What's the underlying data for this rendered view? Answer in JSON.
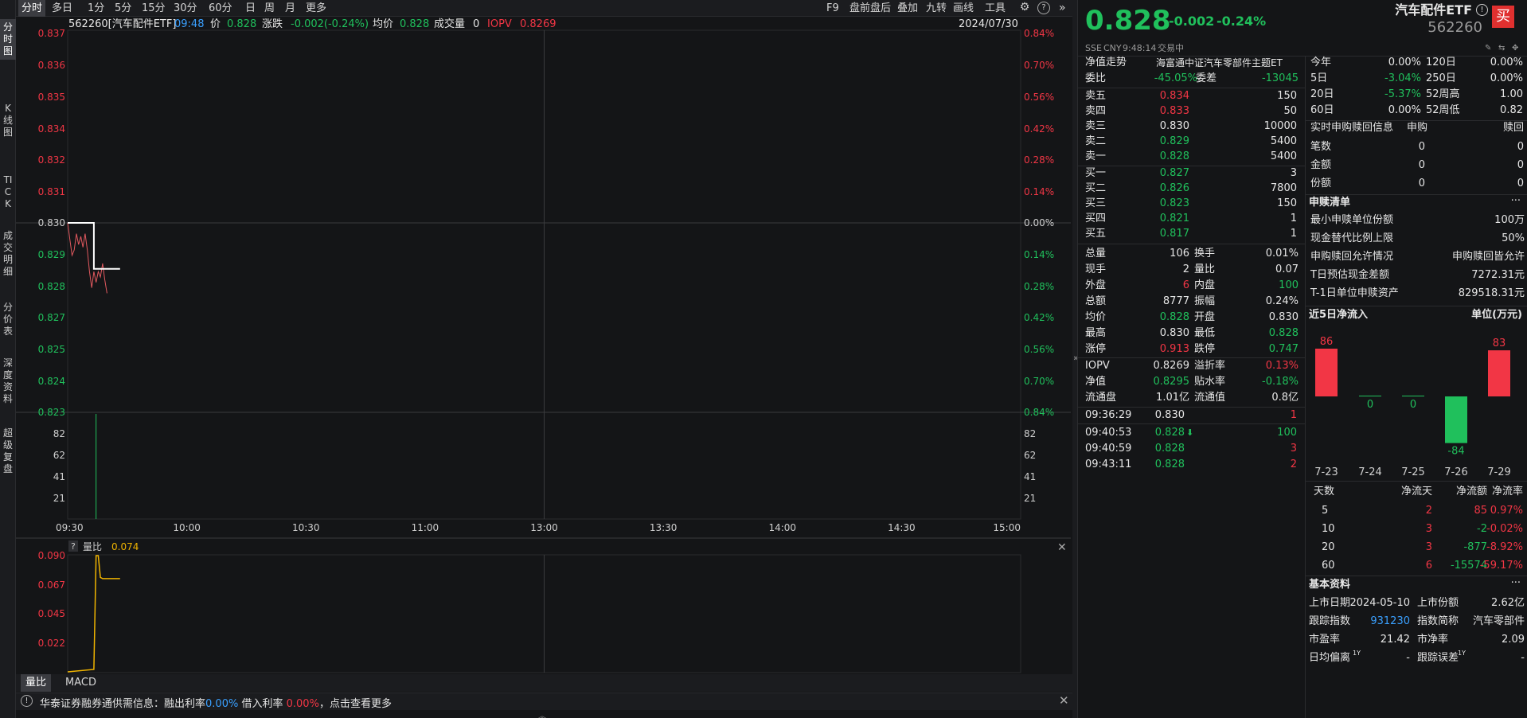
{
  "left_tabs": [
    "分时图",
    "K线图",
    "TICK",
    "成交明细",
    "分价表",
    "深度资料",
    "超级复盘"
  ],
  "toolbar": {
    "periods": [
      "分时",
      "多日",
      "1分",
      "5分",
      "15分",
      "30分",
      "60分",
      "日",
      "周",
      "月",
      "更多"
    ],
    "right_items": [
      "F9",
      "盘前盘后",
      "叠加",
      "九转",
      "画线",
      "工具"
    ],
    "icons": [
      "gear-icon",
      "help-icon",
      "expand-icon"
    ]
  },
  "info": {
    "code_name": "562260[汽车配件ETF]",
    "time": "09:48",
    "price_label": "价",
    "price": "0.828",
    "change_label": "涨跌",
    "change": "-0.002(-0.24%)",
    "avg_label": "均价",
    "avg": "0.828",
    "volume_label": "成交量",
    "volume": "0",
    "iopv_label": "IOPV",
    "iopv": "0.8269",
    "date": "2024/07/30"
  },
  "chart_data": [
    {
      "type": "line",
      "title": "",
      "x_ticks": [
        "09:30",
        "10:00",
        "10:30",
        "11:00",
        "13:00",
        "13:30",
        "14:00",
        "14:30",
        "15:00"
      ],
      "y_left": [
        "0.837",
        "0.836",
        "0.835",
        "0.834",
        "0.832",
        "0.831",
        "0.830",
        "0.829",
        "0.828",
        "0.827",
        "0.825",
        "0.824",
        "0.823"
      ],
      "y_right": [
        "0.84%",
        "0.70%",
        "0.56%",
        "0.42%",
        "0.28%",
        "0.14%",
        "0.00%",
        "0.14%",
        "0.28%",
        "0.42%",
        "0.56%",
        "0.70%",
        "0.84%"
      ],
      "series": [
        {
          "name": "price",
          "color": "#e2595f",
          "x_minutes": [
            0,
            1,
            2,
            3,
            4,
            5,
            6,
            7,
            8,
            9,
            10,
            11,
            12,
            13,
            14,
            15,
            16,
            17,
            18
          ],
          "values": [
            0.83,
            0.8294,
            0.8288,
            0.829,
            0.8296,
            0.8292,
            0.8295,
            0.8291,
            0.8296,
            0.829,
            0.8282,
            0.8276,
            0.8282,
            0.8278,
            0.8282,
            0.828,
            0.8285,
            0.8279,
            0.8274
          ]
        },
        {
          "name": "avg",
          "color": "#ffffff",
          "x_minutes": [
            0,
            12,
            12,
            24
          ],
          "values": [
            0.83,
            0.83,
            0.8283,
            0.8283
          ]
        }
      ]
    },
    {
      "type": "bar",
      "title": "",
      "y_ticks": [
        "82",
        "62",
        "41",
        "21"
      ],
      "x_minutes": [
        13
      ],
      "values": [
        100
      ],
      "color": "#20c05c"
    },
    {
      "type": "line",
      "title": "量比",
      "current_value": "0.074",
      "y_ticks": [
        "0.090",
        "0.067",
        "0.045",
        "0.022"
      ],
      "series": [
        {
          "name": "量比",
          "color": "#f0b400",
          "x_minutes": [
            0,
            12,
            13,
            14,
            15,
            16,
            24
          ],
          "values": [
            0.0,
            0.002,
            0.096,
            0.096,
            0.078,
            0.077,
            0.077
          ]
        }
      ]
    }
  ],
  "sub_tabs": [
    "量比",
    "MACD"
  ],
  "sub_help": "?",
  "bottom_notice": {
    "prefix": "华泰证券融券通供需信息：融出利率",
    "rate1": "0.00%",
    "mid": "借入利率",
    "rate2": "0.00%",
    "suffix": "，点击查看更多"
  },
  "quote": {
    "price": "0.828",
    "change": "-0.002",
    "pct": "-0.24%",
    "name": "汽车配件ETF",
    "code": "562260",
    "buy_label": "买",
    "exchange": "SSE",
    "currency": "CNY",
    "time": "9:48:14",
    "status": "交易中"
  },
  "nav": {
    "label": "净值走势",
    "desc": "海富通中证汽车零部件主题ET"
  },
  "weibi": {
    "label": "委比",
    "value": "-45.05%",
    "label2": "委差",
    "value2": "-13045"
  },
  "asks": [
    {
      "label": "卖五",
      "price": "0.834",
      "vol": "150",
      "color": "red"
    },
    {
      "label": "卖四",
      "price": "0.833",
      "vol": "50",
      "color": "red"
    },
    {
      "label": "卖三",
      "price": "0.830",
      "vol": "10000",
      "color": "white"
    },
    {
      "label": "卖二",
      "price": "0.829",
      "vol": "5400",
      "color": "green"
    },
    {
      "label": "卖一",
      "price": "0.828",
      "vol": "5400",
      "color": "green"
    }
  ],
  "bids": [
    {
      "label": "买一",
      "price": "0.827",
      "vol": "3",
      "color": "green"
    },
    {
      "label": "买二",
      "price": "0.826",
      "vol": "7800",
      "color": "green"
    },
    {
      "label": "买三",
      "price": "0.823",
      "vol": "150",
      "color": "green"
    },
    {
      "label": "买四",
      "price": "0.821",
      "vol": "1",
      "color": "green"
    },
    {
      "label": "买五",
      "price": "0.817",
      "vol": "1",
      "color": "green"
    }
  ],
  "stats": [
    {
      "l1": "总量",
      "v1": "106",
      "c1": "white",
      "l2": "换手",
      "v2": "0.01%",
      "c2": "white"
    },
    {
      "l1": "现手",
      "v1": "2",
      "c1": "white",
      "l2": "量比",
      "v2": "0.07",
      "c2": "white"
    },
    {
      "l1": "外盘",
      "v1": "6",
      "c1": "red",
      "l2": "内盘",
      "v2": "100",
      "c2": "green"
    },
    {
      "l1": "总额",
      "v1": "8777",
      "c1": "white",
      "l2": "振幅",
      "v2": "0.24%",
      "c2": "white"
    },
    {
      "l1": "均价",
      "v1": "0.828",
      "c1": "green",
      "l2": "开盘",
      "v2": "0.830",
      "c2": "white"
    },
    {
      "l1": "最高",
      "v1": "0.830",
      "c1": "white",
      "l2": "最低",
      "v2": "0.828",
      "c2": "green"
    },
    {
      "l1": "涨停",
      "v1": "0.913",
      "c1": "red",
      "l2": "跌停",
      "v2": "0.747",
      "c2": "green"
    }
  ],
  "stats2": [
    {
      "l1": "IOPV",
      "v1": "0.8269",
      "c1": "white",
      "l2": "溢折率",
      "v2": "0.13%",
      "c2": "red"
    },
    {
      "l1": "净值",
      "v1": "0.8295",
      "c1": "green",
      "l2": "贴水率",
      "v2": "-0.18%",
      "c2": "green"
    },
    {
      "l1": "流通盘",
      "v1": "1.01亿",
      "c1": "white",
      "l2": "流通值",
      "v2": "0.8亿",
      "c2": "white"
    }
  ],
  "trades": [
    {
      "time": "09:36:29",
      "price": "0.830",
      "pc": "white",
      "arrow": "",
      "vol": "1",
      "vc": "red"
    },
    {
      "time": "09:40:53",
      "price": "0.828",
      "pc": "green",
      "arrow": "down-arrow-icon",
      "vol": "100",
      "vc": "green"
    },
    {
      "time": "09:40:59",
      "price": "0.828",
      "pc": "green",
      "arrow": "",
      "vol": "3",
      "vc": "red"
    },
    {
      "time": "09:43:11",
      "price": "0.828",
      "pc": "green",
      "arrow": "",
      "vol": "2",
      "vc": "red"
    }
  ],
  "perf": [
    {
      "l1": "今年",
      "v1": "0.00%",
      "l2": "120日",
      "v2": "0.00%"
    },
    {
      "l1": "5日",
      "v1": "-3.04%",
      "l2": "250日",
      "v2": "0.00%"
    },
    {
      "l1": "20日",
      "v1": "-5.37%",
      "l2": "52周高",
      "v2": "1.00"
    },
    {
      "l1": "60日",
      "v1": "0.00%",
      "l2": "52周低",
      "v2": "0.82"
    }
  ],
  "perf_colors": [
    "white",
    "green",
    "green",
    "white"
  ],
  "subscription": {
    "title": "实时申购赎回信息",
    "col1": "申购",
    "col2": "赎回",
    "rows": [
      {
        "label": "笔数",
        "v1": "0",
        "v2": "0"
      },
      {
        "label": "金额",
        "v1": "0",
        "v2": "0"
      },
      {
        "label": "份额",
        "v1": "0",
        "v2": "0"
      }
    ]
  },
  "creation": {
    "title": "申赎清单",
    "more": "···",
    "rows": [
      {
        "label": "最小申赎单位份额",
        "value": "100万"
      },
      {
        "label": "现金替代比例上限",
        "value": "50%"
      },
      {
        "label": "申购赎回允许情况",
        "value": "申购赎回皆允许"
      },
      {
        "label": "T日预估现金差额",
        "value": "7272.31元"
      },
      {
        "label": "T-1日单位申赎资产",
        "value": "829518.31元"
      }
    ]
  },
  "netflow": {
    "title": "近5日净流入",
    "unit": "单位(万元)",
    "chart_data": {
      "type": "bar",
      "categories": [
        "7-23",
        "7-24",
        "7-25",
        "7-26",
        "7-29"
      ],
      "values": [
        86,
        0,
        0,
        -84,
        83
      ],
      "labels": [
        "86",
        "0",
        "0",
        "-84",
        "83"
      ]
    }
  },
  "flowtable": {
    "headers": [
      "天数",
      "净流天",
      "净流额",
      "净流率"
    ],
    "rows": [
      {
        "days": "5",
        "nd": "2",
        "amt": "85",
        "rate": "0.97%",
        "c": "red"
      },
      {
        "days": "10",
        "nd": "3",
        "amt": "-2",
        "rate": "-0.02%",
        "c": "green"
      },
      {
        "days": "20",
        "nd": "3",
        "amt": "-877",
        "rate": "-8.92%",
        "c": "green"
      },
      {
        "days": "60",
        "nd": "6",
        "amt": "-15574",
        "rate": "-59.17%",
        "c": "green"
      }
    ]
  },
  "basic": {
    "title": "基本资料",
    "more": "···",
    "rows": [
      {
        "l1": "上市日期",
        "v1": "2024-05-10",
        "l2": "上市份额",
        "v2": "2.62亿"
      },
      {
        "l1": "跟踪指数",
        "v1": "931230",
        "l2": "指数简称",
        "v2": "汽车零部件"
      },
      {
        "l1": "市盈率",
        "v1": "21.42",
        "l2": "市净率",
        "v2": "2.09"
      },
      {
        "l1": "日均偏离",
        "v1": "-",
        "l2": "跟踪误差",
        "v2": "-"
      }
    ],
    "sup": "1Y"
  }
}
